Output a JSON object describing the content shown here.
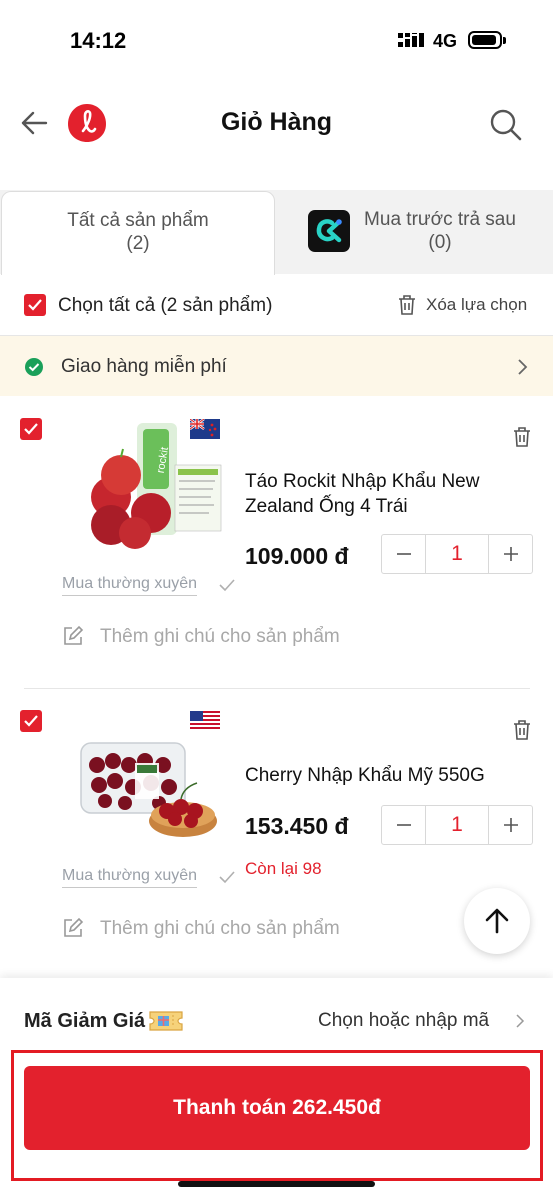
{
  "status": {
    "time": "14:12",
    "network": "4G"
  },
  "header": {
    "title": "Giỏ Hàng"
  },
  "tabs": [
    {
      "label": "Tất cả sản phẩm",
      "count": "(2)"
    },
    {
      "label": "Mua trước trả sau",
      "count": "(0)"
    }
  ],
  "select_all": {
    "label": "Chọn tất cả (2 sản phẩm)",
    "delete_label": "Xóa lựa chọn"
  },
  "shipping": {
    "label": "Giao hàng miễn phí"
  },
  "items": [
    {
      "name_line1": "Táo Rockit Nhập Khẩu New",
      "name_line2": "Zealand Ống 4 Trái",
      "price": "109.000 đ",
      "quantity": "1",
      "buy_often": "Mua thường xuyên",
      "note": "Thêm ghi chú cho sản phẩm",
      "flag": "new-zealand"
    },
    {
      "name_line1": "Cherry Nhập Khẩu Mỹ 550G",
      "price": "153.450 đ",
      "quantity": "1",
      "stock": "Còn lại 98",
      "buy_often": "Mua thường xuyên",
      "note": "Thêm ghi chú cho sản phẩm",
      "flag": "usa"
    }
  ],
  "voucher": {
    "label": "Mã Giảm Giá",
    "action": "Chọn hoặc nhập mã"
  },
  "checkout": {
    "label": "Thanh toán 262.450đ"
  },
  "colors": {
    "accent": "#e3212d",
    "shipping_bg": "#fdf7e8",
    "success": "#1aa05a"
  }
}
